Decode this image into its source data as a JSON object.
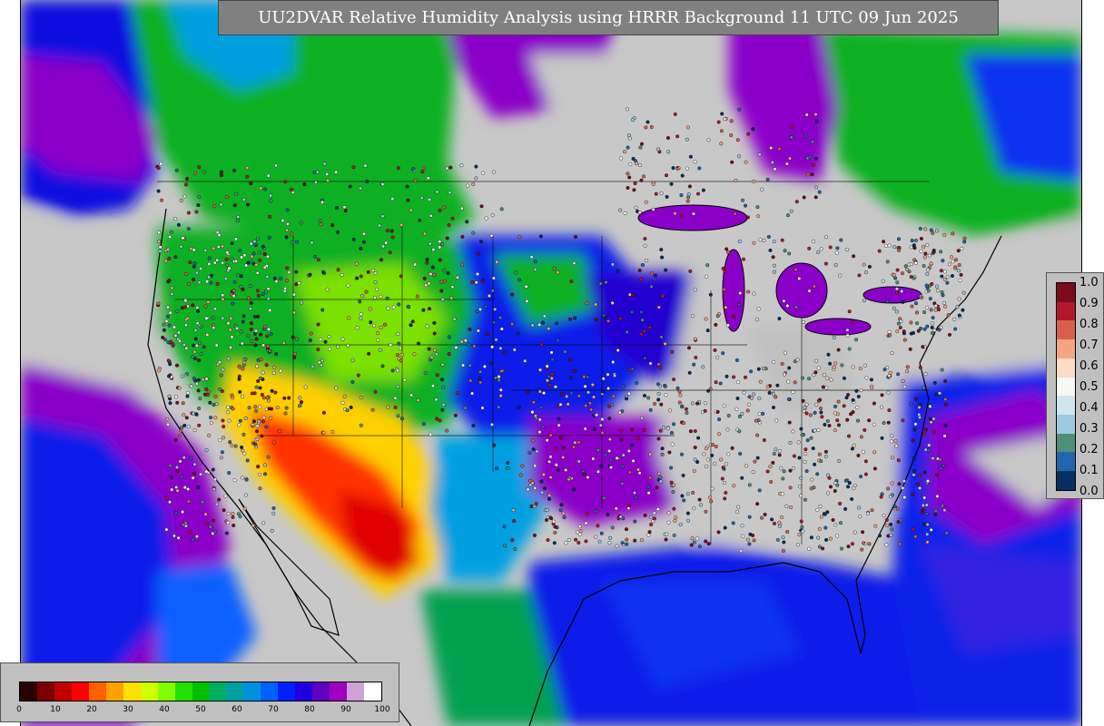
{
  "title": "UU2DVAR Relative Humidity Analysis using HRRR Background 11 UTC 09 Jun 2025",
  "obs_legend": {
    "labels": [
      "1.0",
      "0.9",
      "0.8",
      "0.7",
      "0.6",
      "0.5",
      "0.4",
      "0.3",
      "0.2",
      "0.1",
      "0.0"
    ],
    "colors": [
      "#7a0c1c",
      "#b2182b",
      "#d6604d",
      "#f4a582",
      "#fddbc7",
      "#f7f7f7",
      "#d1e5f0",
      "#9ecae1",
      "#4f8f78",
      "#2166ac",
      "#053061"
    ]
  },
  "rh_legend": {
    "ticks": [
      "0",
      "10",
      "20",
      "30",
      "40",
      "50",
      "60",
      "70",
      "80",
      "90",
      "100"
    ],
    "colors": [
      "#2a0000",
      "#7a0000",
      "#c00000",
      "#ff0000",
      "#ff6000",
      "#ffa000",
      "#ffe000",
      "#d0ff00",
      "#80ff00",
      "#20e000",
      "#00c000",
      "#00b060",
      "#00a0a0",
      "#0090e0",
      "#0060ff",
      "#0020ff",
      "#2000e0",
      "#6000c0",
      "#a000c0",
      "#d0a0d8",
      "#ffffff"
    ]
  },
  "palette": {
    "background": "#c8c8c8",
    "moist": "#0000e0",
    "very_moist": "#8a00c8",
    "green": "#10c010",
    "yellow": "#ffe000",
    "red": "#ff1000"
  }
}
